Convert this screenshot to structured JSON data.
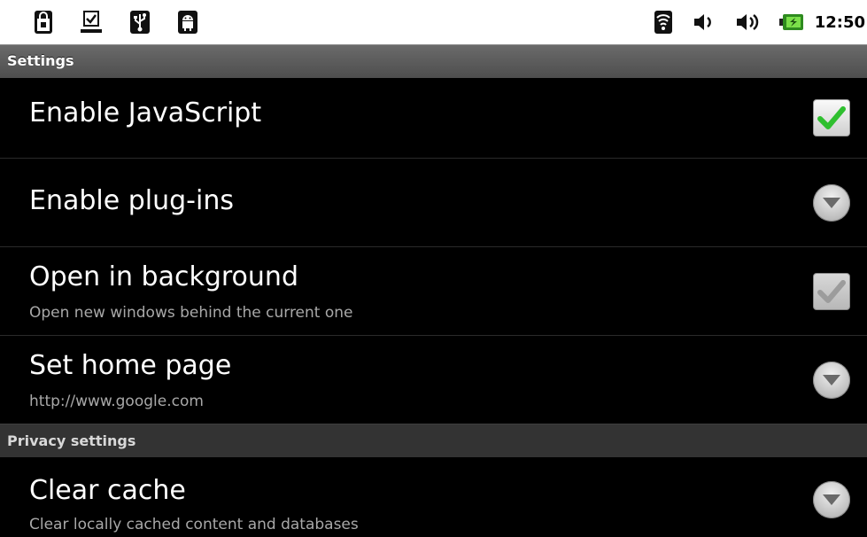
{
  "status_bar": {
    "left_icons": [
      "shopping-bag-icon",
      "download-complete-icon",
      "usb-icon",
      "android-debug-icon"
    ],
    "right_icons": [
      "wifi-icon",
      "volume-icon",
      "volume-icon",
      "battery-charging-icon"
    ],
    "time": "12:50"
  },
  "header": {
    "title": "Settings"
  },
  "items": [
    {
      "title": "Enable JavaScript",
      "summary": "",
      "control": "checkbox",
      "checked": true,
      "enabled": true
    },
    {
      "title": "Enable plug-ins",
      "summary": "",
      "control": "list-arrow"
    },
    {
      "title": "Open in background",
      "summary": "Open new windows behind the current one",
      "control": "checkbox",
      "checked": true,
      "enabled": false
    },
    {
      "title": "Set home page",
      "summary": "http://www.google.com",
      "control": "list-arrow"
    }
  ],
  "privacy_category": {
    "title": "Privacy settings"
  },
  "privacy_items": [
    {
      "title": "Clear cache",
      "summary": "Clear locally cached content and databases",
      "control": "list-arrow"
    }
  ],
  "colors": {
    "check_enabled": "#2fbf2f",
    "check_disabled": "#9c9c9c"
  }
}
